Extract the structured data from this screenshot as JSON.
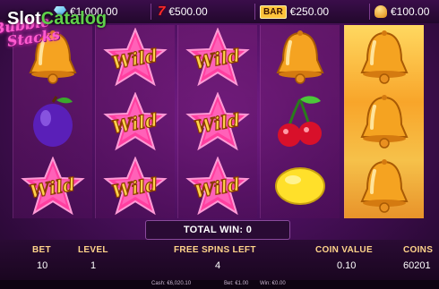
{
  "watermark": {
    "part1": "Slot",
    "part2": "Catalog"
  },
  "logo": {
    "line1": "Bubble",
    "line2": "Stacks"
  },
  "jackpots": [
    {
      "icon": "diamond-icon",
      "value": "€1,000.00"
    },
    {
      "icon": "seven-icon",
      "glyph": "7",
      "value": "€500.00"
    },
    {
      "icon": "bar-icon",
      "glyph": "BAR",
      "value": "€250.00"
    },
    {
      "icon": "bell-icon",
      "value": "€100.00"
    }
  ],
  "reels": [
    [
      "bell",
      "plum",
      "wild"
    ],
    [
      "wild",
      "wild",
      "wild"
    ],
    [
      "wild",
      "wild",
      "wild"
    ],
    [
      "bell",
      "cherry",
      "lemon"
    ],
    [
      "bell",
      "bell",
      "bell"
    ]
  ],
  "highlighted_reel": 4,
  "wild_text": "Wild",
  "total_win": "TOTAL WIN: 0",
  "panel": {
    "bet_label": "BET",
    "bet_value": "10",
    "level_label": "LEVEL",
    "level_value": "1",
    "free_spins_label": "FREE SPINS LEFT",
    "free_spins_value": "4",
    "coin_value_label": "COIN VALUE",
    "coin_value": "0.10",
    "coins_label": "COINS",
    "coins_value": "60201"
  },
  "status": {
    "cash": "Cash: €6,020.10",
    "bet": "Bet: €1.00",
    "win": "Win: €0.00"
  },
  "colors": {
    "bell": "#f5a321",
    "plum": "#5a1fb8",
    "cherry": "#d8102a",
    "lemon": "#ffe02a",
    "wild_star": "#ff3fa0",
    "highlight": "#f8b83a"
  }
}
